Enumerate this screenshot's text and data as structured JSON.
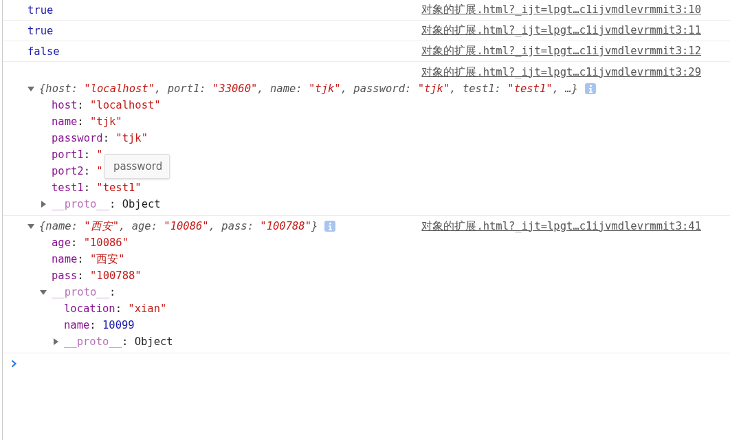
{
  "messages": [
    {
      "kind": "boolean",
      "text": "true",
      "source": "对象的扩展.html?_ijt=lpgt…c1ijvmdlevrmmit3:10"
    },
    {
      "kind": "boolean",
      "text": "true",
      "source": "对象的扩展.html?_ijt=lpgt…c1ijvmdlevrmmit3:11"
    },
    {
      "kind": "boolean",
      "text": "false",
      "source": "对象的扩展.html?_ijt=lpgt…c1ijvmdlevrmmit3:12"
    },
    {
      "kind": "object",
      "source": "对象的扩展.html?_ijt=lpgt…c1ijvmdlevrmmit3:29",
      "source_on_own_line": true,
      "expanded": true,
      "summary": [
        {
          "text": "{host: ",
          "kind": "key"
        },
        {
          "text": "\"localhost\"",
          "kind": "string"
        },
        {
          "text": ", port1: ",
          "kind": "key"
        },
        {
          "text": "\"33060\"",
          "kind": "string"
        },
        {
          "text": ", name: ",
          "kind": "key"
        },
        {
          "text": "\"tjk\"",
          "kind": "string"
        },
        {
          "text": ", password: ",
          "kind": "key"
        },
        {
          "text": "\"tjk\"",
          "kind": "string"
        },
        {
          "text": ", test1: ",
          "kind": "key"
        },
        {
          "text": "\"test1\"",
          "kind": "string"
        },
        {
          "text": ", …}",
          "kind": "key"
        }
      ],
      "properties": [
        {
          "key": "host",
          "colon": ":",
          "value": "\"localhost\"",
          "kind": "string"
        },
        {
          "key": "name",
          "colon": ":",
          "value": "\"tjk\"",
          "kind": "string"
        },
        {
          "key": "password",
          "colon": ":",
          "value": "\"tjk\"",
          "kind": "string"
        },
        {
          "key": "port1",
          "colon": ":",
          "value": "\"",
          "kind": "string"
        },
        {
          "key": "port2",
          "colon": ":",
          "value": "\"",
          "kind": "string"
        },
        {
          "key": "test1",
          "colon": ":",
          "value": "\"test1\"",
          "kind": "string"
        },
        {
          "key": "__proto__",
          "colon": ":",
          "value": "Object",
          "kind": "object",
          "expanded": false
        }
      ],
      "tooltip": {
        "text": "password"
      }
    },
    {
      "kind": "object",
      "source": "对象的扩展.html?_ijt=lpgt…c1ijvmdlevrmmit3:41",
      "source_on_own_line": false,
      "expanded": true,
      "summary": [
        {
          "text": "{name: ",
          "kind": "key"
        },
        {
          "text": "\"西安\"",
          "kind": "string"
        },
        {
          "text": ", age: ",
          "kind": "key"
        },
        {
          "text": "\"10086\"",
          "kind": "string"
        },
        {
          "text": ", pass: ",
          "kind": "key"
        },
        {
          "text": "\"100788\"",
          "kind": "string"
        },
        {
          "text": "}",
          "kind": "key"
        }
      ],
      "properties": [
        {
          "key": "age",
          "colon": ":",
          "value": "\"10086\"",
          "kind": "string"
        },
        {
          "key": "name",
          "colon": ":",
          "value": "\"西安\"",
          "kind": "string"
        },
        {
          "key": "pass",
          "colon": ":",
          "value": "\"100788\"",
          "kind": "string"
        },
        {
          "key": "__proto__",
          "colon": ":",
          "expanded": true,
          "children": [
            {
              "key": "location",
              "colon": ":",
              "value": "\"xian\"",
              "kind": "string"
            },
            {
              "key": "name",
              "colon": ":",
              "value": "10099",
              "kind": "number"
            },
            {
              "key": "__proto__",
              "colon": ":",
              "value": "Object",
              "kind": "object",
              "expanded": false
            }
          ]
        }
      ]
    }
  ]
}
